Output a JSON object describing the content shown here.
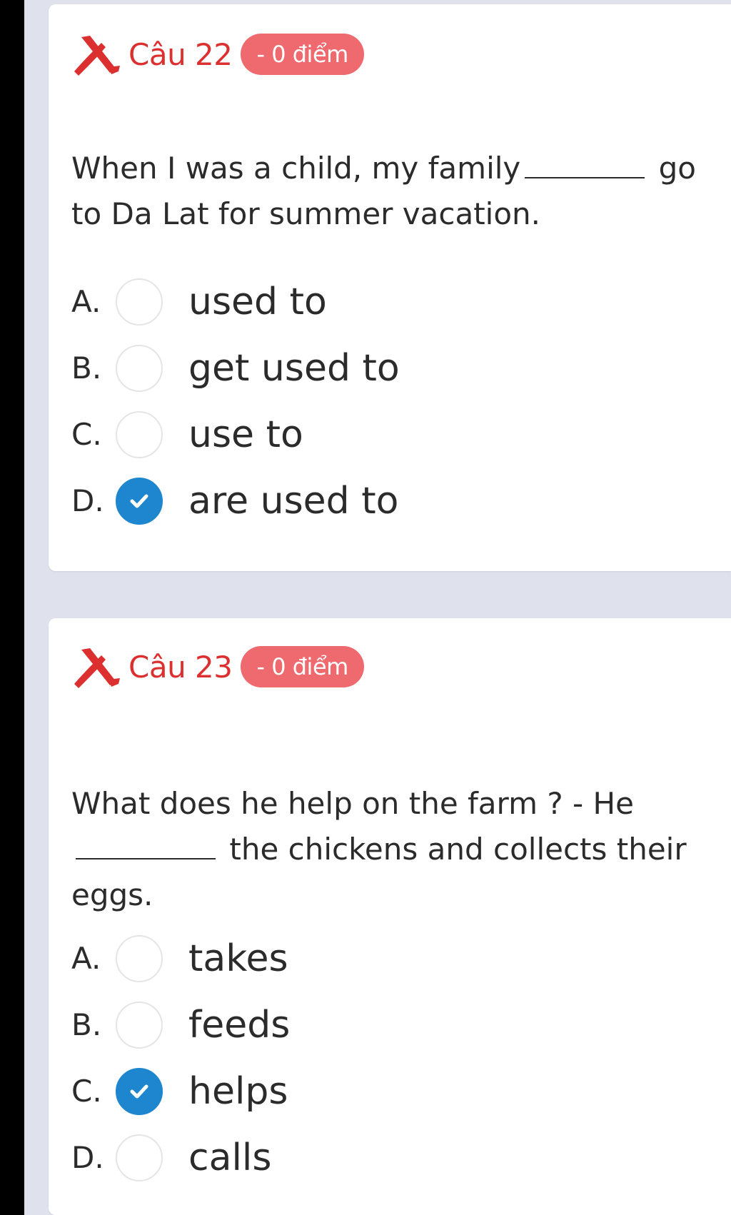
{
  "questions": [
    {
      "title": "Câu 22",
      "score_badge": "- 0 điểm",
      "status_icon": "x-mark-icon",
      "text_before": "When I was a child, my family",
      "text_after": "go to Da Lat for summer vacation.",
      "options": [
        {
          "letter": "A.",
          "text": "used to",
          "selected": false
        },
        {
          "letter": "B.",
          "text": "get used to",
          "selected": false
        },
        {
          "letter": "C.",
          "text": "use to",
          "selected": false
        },
        {
          "letter": "D.",
          "text": "are used to",
          "selected": true
        }
      ]
    },
    {
      "title": "Câu 23",
      "score_badge": "- 0 điểm",
      "status_icon": "x-mark-icon",
      "text_before": "What does he help on the farm ? - He",
      "text_after": "the chickens and collects their eggs.",
      "options": [
        {
          "letter": "A.",
          "text": "takes",
          "selected": false
        },
        {
          "letter": "B.",
          "text": "feeds",
          "selected": false
        },
        {
          "letter": "C.",
          "text": "helps",
          "selected": true
        },
        {
          "letter": "D.",
          "text": "calls",
          "selected": false
        }
      ]
    }
  ],
  "colors": {
    "wrong_red": "#dc3030",
    "badge_bg": "#ee6a6f",
    "check_blue": "#1d86ce",
    "page_bg": "#dfe2ec"
  }
}
